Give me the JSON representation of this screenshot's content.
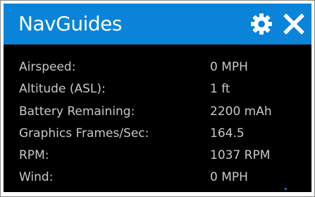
{
  "header": {
    "title": "NavGuides",
    "accent_color": "#0a84d8",
    "settings_icon": "gear-icon",
    "close_icon": "close-icon"
  },
  "stats": [
    {
      "label": "Airspeed:",
      "value": "0 MPH"
    },
    {
      "label": "Altitude (ASL):",
      "value": "1 ft"
    },
    {
      "label": "Battery Remaining:",
      "value": "2200 mAh"
    },
    {
      "label": "Graphics Frames/Sec:",
      "value": "164.5"
    },
    {
      "label": "RPM:",
      "value": "1037 RPM"
    },
    {
      "label": "Wind:",
      "value": "0 MPH"
    }
  ]
}
